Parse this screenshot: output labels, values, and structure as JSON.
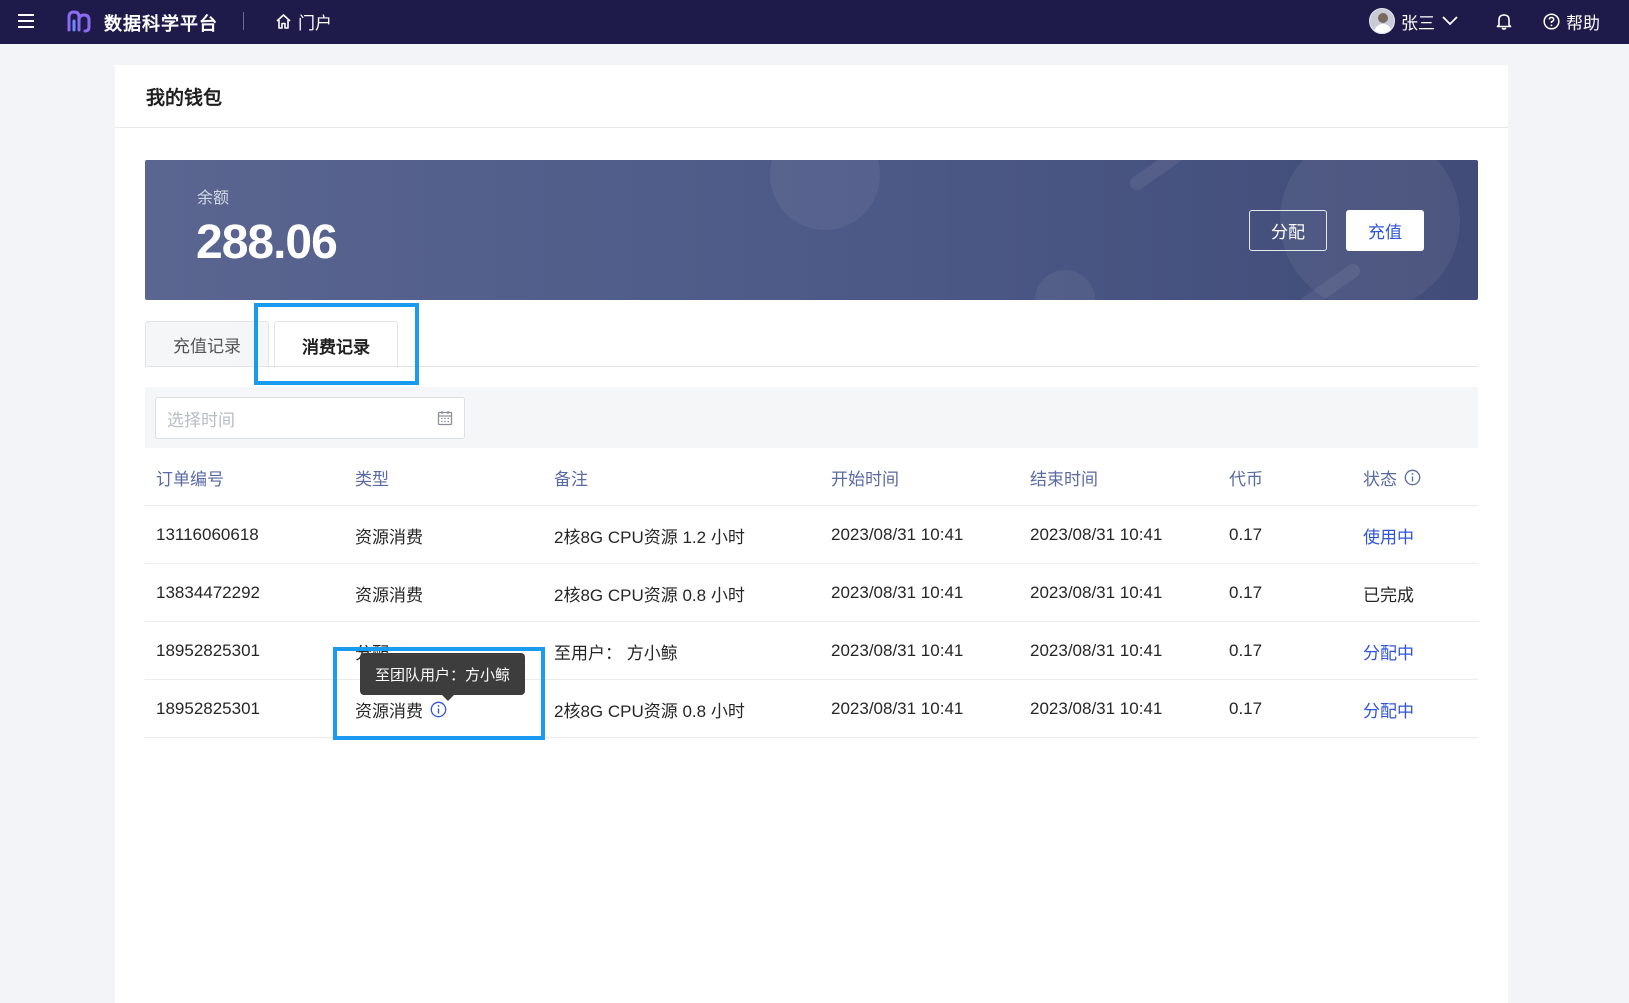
{
  "topbar": {
    "app_title": "数据科学平台",
    "portal_label": "门户",
    "user_name": "张三",
    "help_label": "帮助",
    "bg_color": "#1e1b4b"
  },
  "page": {
    "title": "我的钱包"
  },
  "wallet": {
    "balance_label": "余额",
    "balance_value": "288.06",
    "allocate_label": "分配",
    "recharge_label": "充值"
  },
  "tabs": [
    {
      "label": "充值记录",
      "active": false
    },
    {
      "label": "消费记录",
      "active": true
    }
  ],
  "filter": {
    "date_placeholder": "选择时间"
  },
  "table": {
    "headers": [
      "订单编号",
      "类型",
      "备注",
      "开始时间",
      "结束时间",
      "代币",
      "状态"
    ],
    "rows": [
      {
        "order": "13116060618",
        "type": "资源消费",
        "note": "2核8G CPU资源 1.2 小时",
        "start": "2023/08/31 10:41",
        "end": "2023/08/31 10:41",
        "tokens": "0.17",
        "status": "使用中",
        "status_color": "#2f54d8"
      },
      {
        "order": "13834472292",
        "type": "资源消费",
        "note": "2核8G CPU资源 0.8 小时",
        "start": "2023/08/31 10:41",
        "end": "2023/08/31 10:41",
        "tokens": "0.17",
        "status": "已完成",
        "status_color": "#262626"
      },
      {
        "order": "18952825301",
        "type": "分配",
        "note": "至用户： 方小鲸",
        "start": "2023/08/31 10:41",
        "end": "2023/08/31 10:41",
        "tokens": "0.17",
        "status": "分配中",
        "status_color": "#2f54d8"
      },
      {
        "order": "18952825301",
        "type": "资源消费",
        "note": "2核8G CPU资源 0.8 小时",
        "start": "2023/08/31 10:41",
        "end": "2023/08/31 10:41",
        "tokens": "0.17",
        "status": "分配中",
        "status_color": "#2f54d8"
      }
    ]
  },
  "tooltip": {
    "text": "至团队用户：方小鲸"
  },
  "colors": {
    "accent": "#2f54d8",
    "highlight": "#1a9bf0",
    "header_text": "#5a6aa3"
  }
}
